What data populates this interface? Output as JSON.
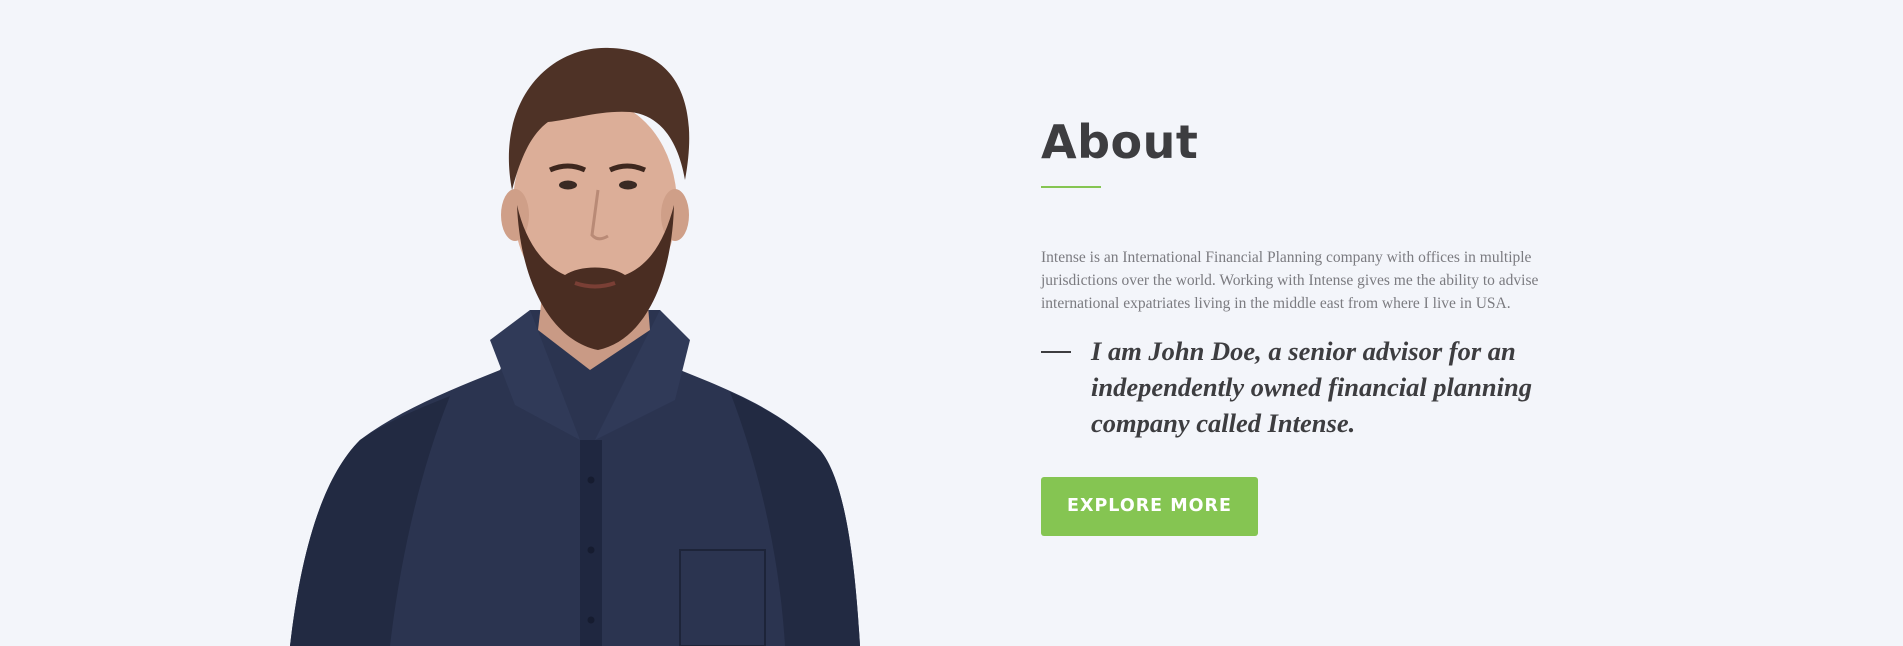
{
  "about": {
    "title": "About",
    "paragraph": "Intense is an International Financial Planning company with offices in multiple jurisdictions over the world. Working with Intense gives me the ability to advise international expatriates living in the middle east from where I live in USA.",
    "quote": "I am John Doe, a senior advisor for an independently owned financial planning company called Intense.",
    "button_label": "Explore more"
  },
  "colors": {
    "background": "#f3f5fa",
    "accent": "#85c552",
    "heading": "#3d3d40",
    "body_text": "#7b7b80"
  },
  "images": {
    "portrait": "advisor-portrait"
  }
}
